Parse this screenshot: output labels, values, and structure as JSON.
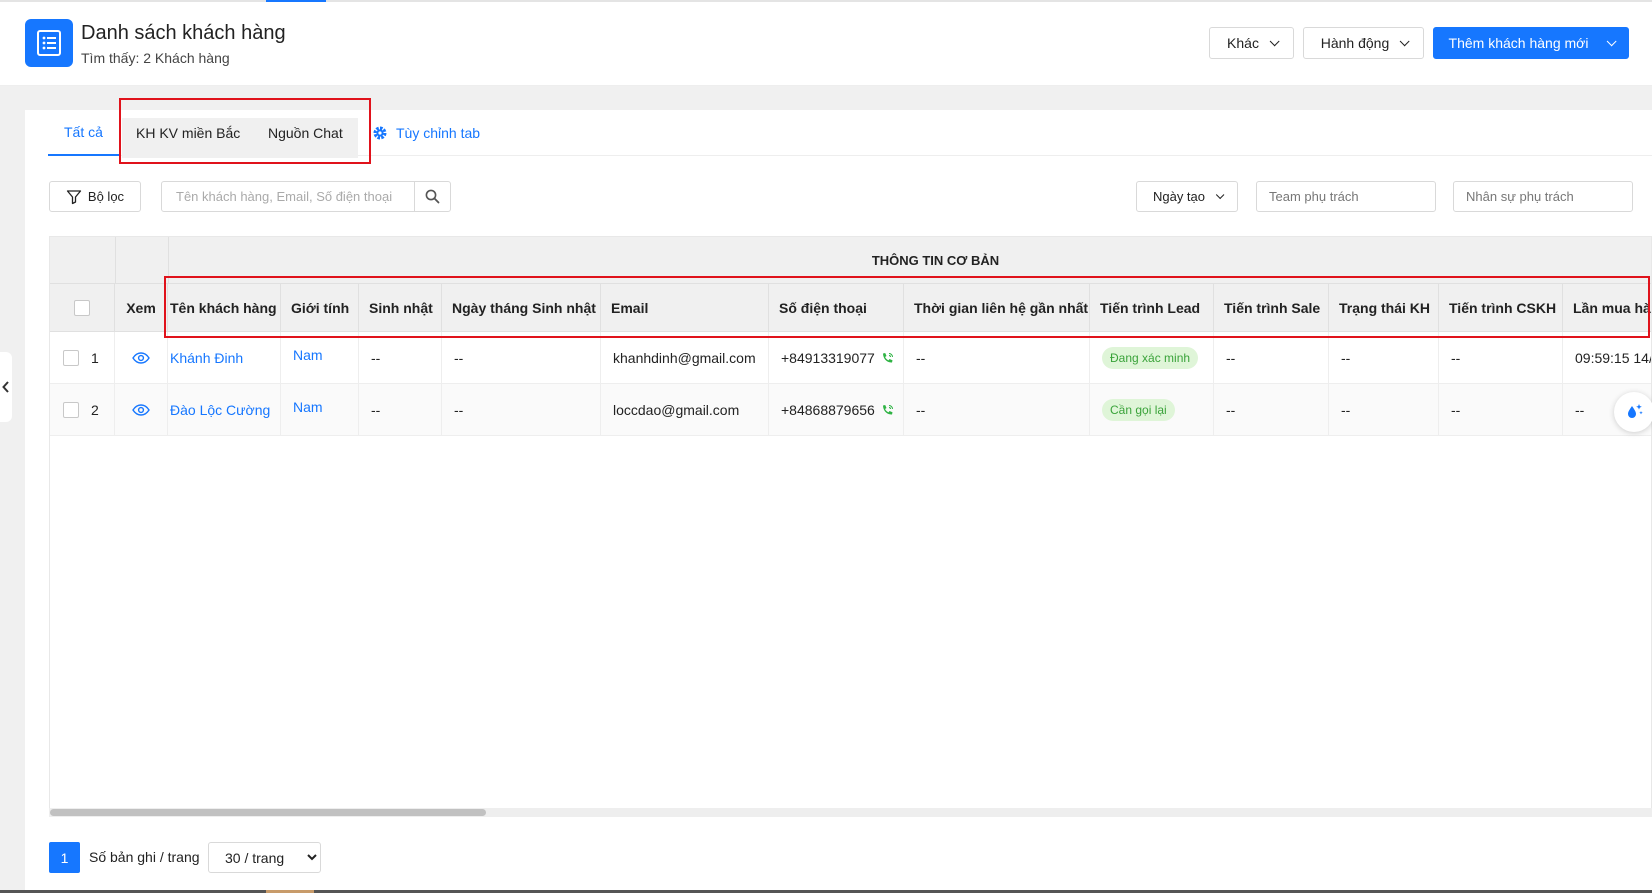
{
  "header": {
    "title": "Danh sách khách hàng",
    "subtitle": "Tìm thấy: 2 Khách hàng",
    "buttons": {
      "other": "Khác",
      "action": "Hành động",
      "add": "Thêm khách hàng mới"
    }
  },
  "tabs": {
    "all": "Tất cả",
    "north": "KH KV miền Bắc",
    "chat": "Nguồn Chat",
    "customize": "Tùy chỉnh tab"
  },
  "filters": {
    "filter_label": "Bộ lọc",
    "search_placeholder": "Tên khách hàng, Email, Số điện thoại",
    "date_label": "Ngày tạo",
    "team_placeholder": "Team phụ trách",
    "staff_placeholder": "Nhân sự phụ trách"
  },
  "table": {
    "group_title": "THÔNG TIN CƠ BẢN",
    "columns": {
      "view": "Xem",
      "name": "Tên khách hàng",
      "gender": "Giới tính",
      "birthday": "Sinh nhật",
      "birth_date": "Ngày tháng Sinh nhật",
      "email": "Email",
      "phone": "Số điện thoại",
      "last_contact": "Thời gian liên hệ gần nhất",
      "lead": "Tiến trình Lead",
      "sale": "Tiến trình Sale",
      "status": "Trạng thái KH",
      "cskh": "Tiến trình CSKH",
      "last_purchase": "Lần mua hà"
    },
    "rows": [
      {
        "index": "1",
        "name": "Khánh Đinh",
        "gender": "Nam",
        "birthday": "--",
        "birth_date": "--",
        "email": "khanhdinh@gmail.com",
        "phone": "+84913319077",
        "last_contact": "--",
        "lead": "Đang xác minh",
        "sale": "--",
        "status": "--",
        "cskh": "--",
        "last_purchase": "09:59:15 14/"
      },
      {
        "index": "2",
        "name": "Đào Lộc Cường",
        "gender": "Nam",
        "birthday": "--",
        "birth_date": "--",
        "email": "loccdao@gmail.com",
        "phone": "+84868879656",
        "last_contact": "--",
        "lead": "Cần gọi lại",
        "sale": "--",
        "status": "--",
        "cskh": "--",
        "last_purchase": "--"
      }
    ]
  },
  "pagination": {
    "current_page": "1",
    "per_page_label": "Số bản ghi / trang",
    "per_page_value": "30 / trang"
  },
  "colors": {
    "primary": "#1677ff",
    "highlight": "#e0121b",
    "badge_bg": "#dff5d8",
    "badge_text": "#3aa33a",
    "phone_icon": "#2fb344"
  },
  "icons": [
    "list-icon",
    "chevron-down-icon",
    "gear-icon",
    "filter-icon",
    "search-icon",
    "eye-icon",
    "phone-icon",
    "chevron-left-icon",
    "assistant-icon"
  ]
}
